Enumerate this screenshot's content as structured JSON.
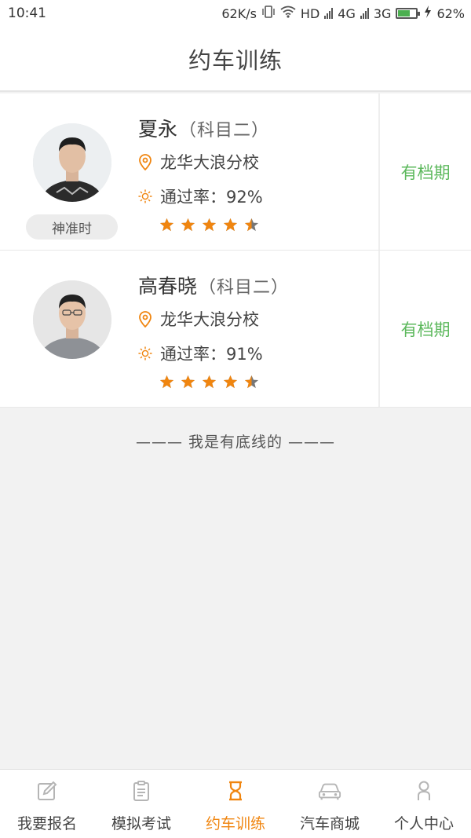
{
  "status_bar": {
    "time": "10:41",
    "speed": "62K/s",
    "hd": "HD",
    "net1": "4G",
    "net2": "3G",
    "battery": "62%"
  },
  "header": {
    "title": "约车训练"
  },
  "coaches": [
    {
      "name": "夏永",
      "subject": "（科目二）",
      "school": "龙华大浪分校",
      "pass_rate": "通过率：92%",
      "rating": 4.5,
      "badge": "神准时",
      "status": "有档期"
    },
    {
      "name": "高春晓",
      "subject": "（科目二）",
      "school": "龙华大浪分校",
      "pass_rate": "通过率：91%",
      "rating": 4.5,
      "badge": "",
      "status": "有档期"
    }
  ],
  "bottom_line": "——— 我是有底线的 ———",
  "tabs": [
    {
      "label": "我要报名",
      "icon": "edit-icon",
      "active": false
    },
    {
      "label": "模拟考试",
      "icon": "clipboard-icon",
      "active": false
    },
    {
      "label": "约车训练",
      "icon": "hourglass-icon",
      "active": true
    },
    {
      "label": "汽车商城",
      "icon": "car-icon",
      "active": false
    },
    {
      "label": "个人中心",
      "icon": "person-icon",
      "active": false
    }
  ],
  "colors": {
    "accent": "#f0850f",
    "status_green": "#5cb85c",
    "star_orange": "#f0850f",
    "star_gray": "#777777"
  }
}
